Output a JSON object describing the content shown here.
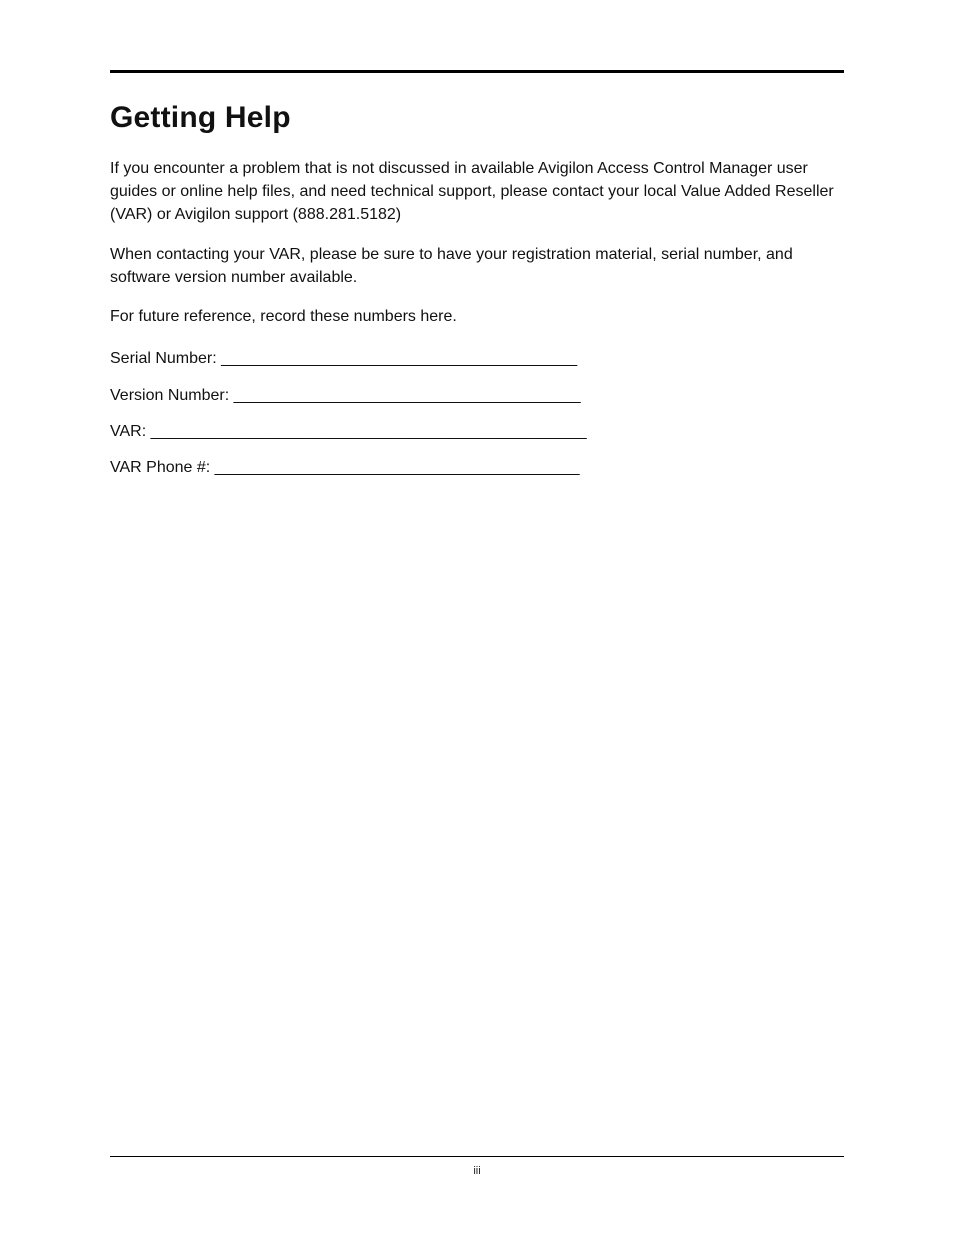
{
  "title": "Getting Help",
  "paragraphs": {
    "p1": "If you encounter a problem that is not discussed in available Avigilon Access Control Manager user guides or online help files, and need technical support, please contact your local Value Added Reseller (VAR) or Avigilon support (888.281.5182)",
    "p2": "When contacting your VAR, please be sure to have your registration material, serial number, and software version number available.",
    "p3": "For future reference, record these numbers here."
  },
  "fields": {
    "serial": "Serial Number: ________________________________________",
    "version": "Version Number: _______________________________________",
    "var": "VAR: _________________________________________________",
    "varphone": "VAR Phone #: _________________________________________"
  },
  "page_number": "iii"
}
